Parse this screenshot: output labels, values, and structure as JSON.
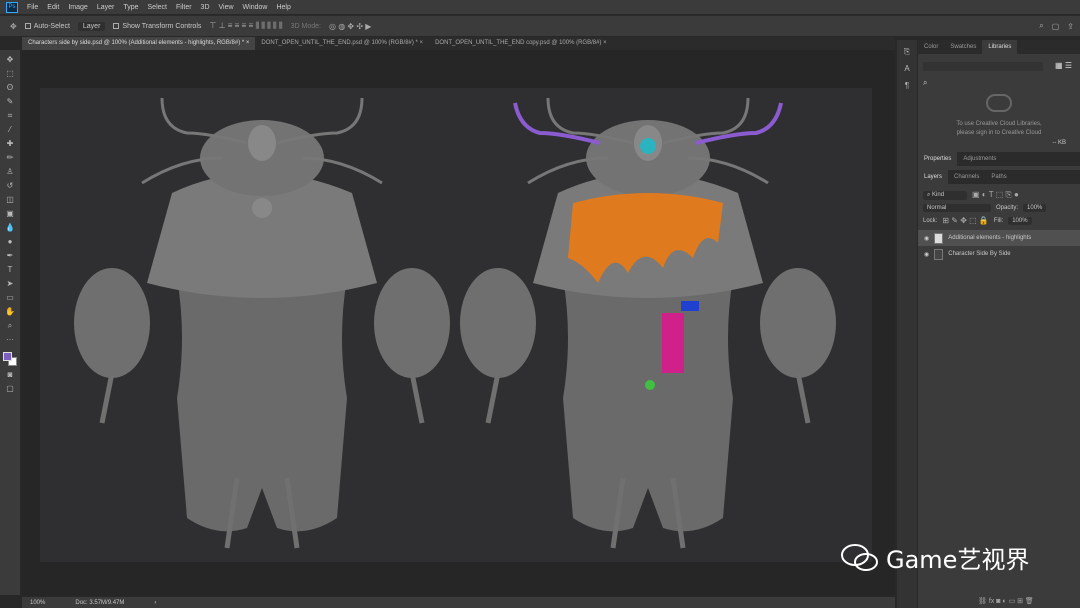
{
  "menu": [
    "File",
    "Edit",
    "Image",
    "Layer",
    "Type",
    "Select",
    "Filter",
    "3D",
    "View",
    "Window",
    "Help"
  ],
  "app_logo": "Ps",
  "options": {
    "auto_select": "Auto-Select",
    "layer_select": "Layer",
    "transform": "Show Transform Controls",
    "mode_3d": "3D Mode:"
  },
  "tabs": [
    {
      "label": "Characters side by side.psd @ 100% (Additional elements - highlights, RGB/8#) *",
      "close": "×"
    },
    {
      "label": "DONT_OPEN_UNTIL_THE_END.psd @ 100% (RGB/8#) *",
      "close": "×"
    },
    {
      "label": "DONT_OPEN_UNTIL_THE_END copy.psd @ 100% (RGB/8#)",
      "close": "×"
    }
  ],
  "status": {
    "zoom": "100%",
    "doc": "Doc: 3.57M/9.47M",
    "arrow": "›"
  },
  "panels": {
    "top_tabs": [
      "Color",
      "Swatches",
      "Libraries"
    ],
    "lib_message_1": "To use Creative Cloud Libraries,",
    "lib_message_2": "please sign in to Creative Cloud",
    "lib_size": "-- KB",
    "mid_tabs": [
      "Properties",
      "Adjustments"
    ],
    "layer_tabs": [
      "Layers",
      "Channels",
      "Paths"
    ],
    "kind": "Kind",
    "blend": "Normal",
    "opacity_label": "Opacity:",
    "opacity": "100%",
    "lock_label": "Lock:",
    "fill_label": "Fill:",
    "fill": "100%",
    "layers": [
      {
        "name": "Additional elements - highlights",
        "active": true
      },
      {
        "name": "Character Side By Side",
        "active": false
      }
    ]
  },
  "watermark": "Game艺视界",
  "colors": {
    "foreground": "#7c5fbf",
    "background": "#ffffff",
    "highlight_orange": "#e07a1e",
    "highlight_purple": "#8a5cd0",
    "highlight_magenta": "#d0208a",
    "highlight_cyan": "#2bb3c0"
  }
}
